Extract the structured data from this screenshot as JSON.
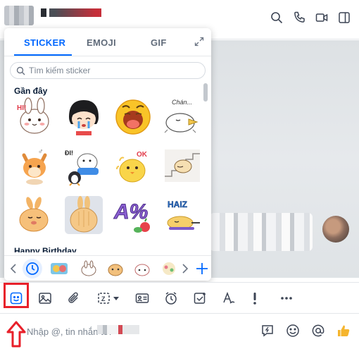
{
  "header": {
    "contact_name": "",
    "icons": [
      "search-icon",
      "phone-icon",
      "video-icon",
      "sidebar-toggle-icon"
    ]
  },
  "sticker_panel": {
    "tabs": [
      {
        "label": "STICKER",
        "active": true
      },
      {
        "label": "EMOJI",
        "active": false
      },
      {
        "label": "GIF",
        "active": false
      }
    ],
    "search_placeholder": "Tìm kiếm sticker",
    "section_recent": "Gần đây",
    "section_next": "Happy Birthday",
    "stickers": [
      {
        "name": "sticker-bunny-hi",
        "text": "HI!"
      },
      {
        "name": "sticker-girl-crying",
        "text": ""
      },
      {
        "name": "sticker-yellow-yawn",
        "text": ""
      },
      {
        "name": "sticker-bored-duck",
        "text": "Chán..."
      },
      {
        "name": "sticker-fox-dizzy",
        "text": ""
      },
      {
        "name": "sticker-bear-penguin",
        "text": "ĐI!"
      },
      {
        "name": "sticker-chick-ok",
        "text": "OK"
      },
      {
        "name": "sticker-cat-stairs",
        "text": ""
      },
      {
        "name": "sticker-bunny-sleep",
        "text": ""
      },
      {
        "name": "sticker-bunny-back",
        "text": ""
      },
      {
        "name": "sticker-percent-fruit",
        "text": "A%"
      },
      {
        "name": "sticker-haiz-lying",
        "text": "HAIZ"
      }
    ],
    "tray": [
      "recent-icon",
      "sticker-pack-1",
      "sticker-pack-2",
      "sticker-pack-3",
      "sticker-pack-4",
      "sticker-pack-5"
    ]
  },
  "toolbar": {
    "icons": [
      "sticker-icon",
      "image-icon",
      "attachment-icon",
      "screenshot-icon",
      "business-card-icon",
      "reminder-icon",
      "todo-icon",
      "format-text-icon",
      "urgent-icon",
      "more-icon"
    ],
    "selected": "sticker-icon"
  },
  "message_input": {
    "placeholder": "Nhập @, tin nhắn tới",
    "recipient": "",
    "icons": [
      "quick-reply-icon",
      "emoji-icon",
      "mention-icon",
      "like-icon"
    ]
  },
  "colors": {
    "accent": "#0068ff",
    "highlight": "#e8202a",
    "like": "#f5b52e"
  }
}
